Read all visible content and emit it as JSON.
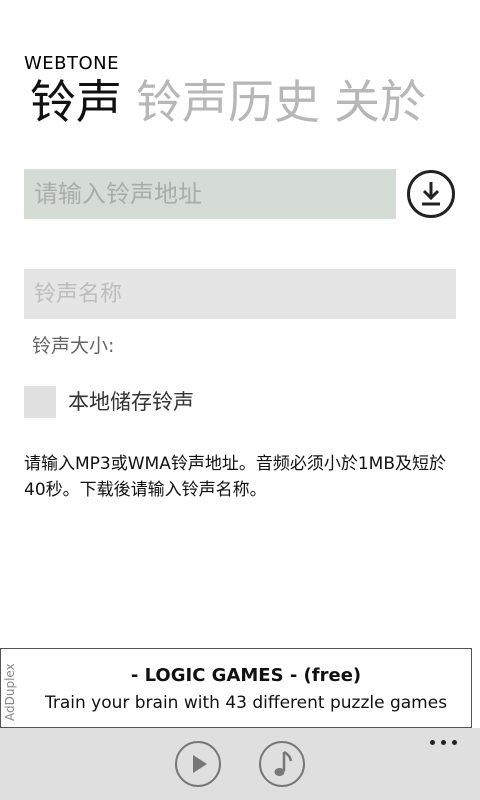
{
  "app": {
    "title": "WEBTONE"
  },
  "pivot": {
    "tabs": [
      {
        "label": "铃声",
        "active": true
      },
      {
        "label": "铃声历史",
        "active": false
      },
      {
        "label": "关於",
        "active": false
      }
    ]
  },
  "form": {
    "url_input": {
      "placeholder": "请输入铃声地址",
      "value": ""
    },
    "download_icon": "download-arrow-icon",
    "name_input": {
      "placeholder": "铃声名称",
      "value": ""
    },
    "size_label": "铃声大小:",
    "save_checkbox": {
      "label": "本地储存铃声",
      "checked": false
    },
    "instructions": "请输入MP3或WMA铃声地址。音频必须小於1MB及短於40秒。下载後请输入铃声名称。"
  },
  "ad": {
    "brand": "AdDuplex",
    "headline": "- LOGIC GAMES - (free)",
    "body": "Train your brain with 43 different puzzle games"
  },
  "app_bar": {
    "buttons": [
      {
        "name": "play-button",
        "icon": "play-icon"
      },
      {
        "name": "music-button",
        "icon": "music-note-icon"
      }
    ],
    "more_icon": "ellipsis-icon"
  },
  "colors": {
    "accent_text": "#111111",
    "inactive_tab": "#b7b7b7",
    "url_input_bg": "#d5dcd6",
    "name_input_bg": "#e5e5e6",
    "app_bar_bg": "#dfdfdf"
  }
}
